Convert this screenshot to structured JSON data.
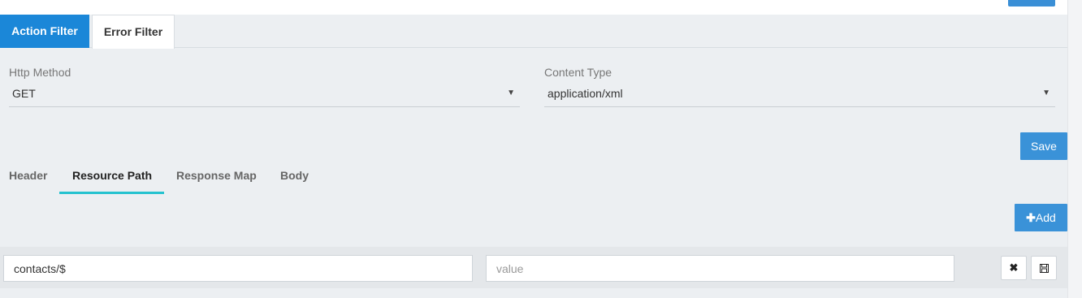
{
  "filter_tabs": {
    "action_filter": "Action Filter",
    "error_filter": "Error Filter"
  },
  "http_method": {
    "label": "Http Method",
    "value": "GET"
  },
  "content_type": {
    "label": "Content Type",
    "value": "application/xml"
  },
  "caret": "▼",
  "save_label": "Save",
  "subtabs": {
    "header": "Header",
    "resource_path": "Resource Path",
    "response_map": "Response Map",
    "body": "Body"
  },
  "add_button": {
    "icon": "plus-icon",
    "label": "Add"
  },
  "resource_row": {
    "key_value": "contacts/$",
    "value_placeholder": "value",
    "delete_icon": "close-icon",
    "save_icon": "floppy-disk-icon"
  },
  "colors": {
    "primary": "#1b87d8",
    "button": "#3a92d8",
    "tab_underline": "#25c2cf",
    "background": "#eceff2"
  }
}
